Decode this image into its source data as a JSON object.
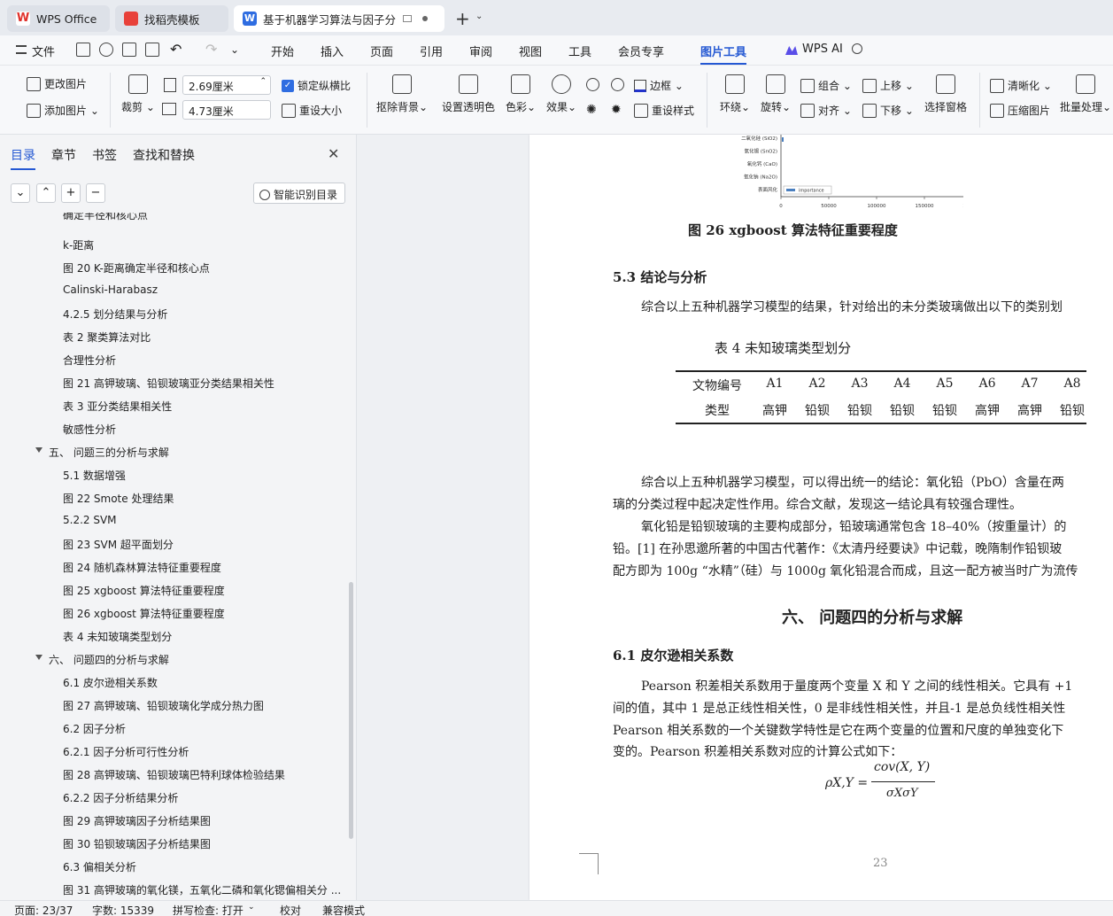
{
  "tabs": [
    {
      "label": "WPS Office"
    },
    {
      "label": "找稻壳模板"
    },
    {
      "label": "基于机器学习算法与因子分析的"
    }
  ],
  "menu": [
    "文件",
    "开始",
    "插入",
    "页面",
    "引用",
    "审阅",
    "视图",
    "工具",
    "会员专享",
    "图片工具",
    "WPS AI"
  ],
  "ribbon": {
    "change_image": "更改图片",
    "add_image": "添加图片",
    "crop": "裁剪",
    "height_value": "2.69厘米",
    "width_value": "4.73厘米",
    "lock_ratio": "锁定纵横比",
    "reset_size": "重设大小",
    "remove_bg": "抠除背景",
    "set_transparent": "设置透明色",
    "color": "色彩",
    "effect": "效果",
    "border": "边框",
    "reset_style": "重设样式",
    "wrap": "环绕",
    "rotate": "旋转",
    "group": "组合",
    "align": "对齐",
    "bring_forward": "上移",
    "send_backward": "下移",
    "selection_pane": "选择窗格",
    "sharpen": "清晰化",
    "compress": "压缩图片",
    "batch": "批量处理"
  },
  "nav": {
    "tabs": [
      "目录",
      "章节",
      "书签",
      "查找和替换"
    ],
    "smart_btn": "智能识别目录",
    "items": [
      {
        "t": "确定半径和核心点",
        "l": 2
      },
      {
        "t": "k-距离",
        "l": 2
      },
      {
        "t": "图 20 K-距离确定半径和核心点",
        "l": 2
      },
      {
        "t": "Calinski-Harabasz",
        "l": 2
      },
      {
        "t": "4.2.5 划分结果与分析",
        "l": 2
      },
      {
        "t": "表 2 聚类算法对比",
        "l": 2
      },
      {
        "t": "合理性分析",
        "l": 2
      },
      {
        "t": "图 21 高钾玻璃、铅钡玻璃亚分类结果相关性",
        "l": 2
      },
      {
        "t": "表 3 亚分类结果相关性",
        "l": 2
      },
      {
        "t": "敏感性分析",
        "l": 2
      },
      {
        "t": "五、 问题三的分析与求解",
        "l": 1
      },
      {
        "t": "5.1 数据增强",
        "l": 2
      },
      {
        "t": "图 22 Smote 处理结果",
        "l": 2
      },
      {
        "t": "5.2.2 SVM",
        "l": 2
      },
      {
        "t": "图 23 SVM 超平面划分",
        "l": 2
      },
      {
        "t": "图 24 随机森林算法特征重要程度",
        "l": 2
      },
      {
        "t": "图 25 xgboost 算法特征重要程度",
        "l": 2
      },
      {
        "t": "图 26 xgboost 算法特征重要程度",
        "l": 2
      },
      {
        "t": "表 4 未知玻璃类型划分",
        "l": 2
      },
      {
        "t": "六、 问题四的分析与求解",
        "l": 1
      },
      {
        "t": "6.1 皮尔逊相关系数",
        "l": 2
      },
      {
        "t": "图 27 高钾玻璃、铅钡玻璃化学成分热力图",
        "l": 2
      },
      {
        "t": "6.2 因子分析",
        "l": 2
      },
      {
        "t": "6.2.1 因子分析可行性分析",
        "l": 2
      },
      {
        "t": "图 28 高钾玻璃、铅钡玻璃巴特利球体检验结果",
        "l": 2
      },
      {
        "t": "6.2.2 因子分析结果分析",
        "l": 2
      },
      {
        "t": "图 29 高钾玻璃因子分析结果图",
        "l": 2
      },
      {
        "t": "图 30 铅钡玻璃因子分析结果图",
        "l": 2
      },
      {
        "t": "6.3 偏相关分析",
        "l": 2
      },
      {
        "t": "图 31 高钾玻璃的氧化镁，五氧化二磷和氧化锶偏相关分 ...",
        "l": 2
      }
    ]
  },
  "doc": {
    "chart_labels": [
      "二氧化硅 (SiO2)",
      "氧化锡 (SnO2)",
      "氧化钙 (CaO)",
      "氧化钠 (Na2O)",
      "表面风化"
    ],
    "chart_xticks": [
      "0",
      "50000",
      "100000",
      "150000",
      "200000",
      "250000"
    ],
    "chart_legend": "importance",
    "fig26": "图 26   xgboost 算法特征重要程度",
    "sec53": "5.3 结论与分析",
    "p1": "综合以上五种机器学习模型的结果，针对给出的未分类玻璃做出以下的类别划",
    "table_title": "表 4   未知玻璃类型划分",
    "table_head": [
      "文物编号",
      "A1",
      "A2",
      "A3",
      "A4",
      "A5",
      "A6",
      "A7",
      "A8"
    ],
    "table_row": [
      "类型",
      "高钾",
      "铅钡",
      "铅钡",
      "铅钡",
      "铅钡",
      "高钾",
      "高钾",
      "铅钡"
    ],
    "p2a": "综合以上五种机器学习模型，可以得出统一的结论：氧化铅（PbO）含量在两",
    "p2b": "璃的分类过程中起决定性作用。综合文献，发现这一结论具有较强合理性。",
    "p3a": "氧化铅是铅钡玻璃的主要构成部分，铅玻璃通常包含 18–40%（按重量计）的",
    "p3b": "铅。[1] 在孙思邈所著的中国古代著作：《太清丹经要诀》中记载，晚隋制作铅钡玻",
    "p3c": "配方即为 100g “水精”（硅）与 1000g 氧化铅混合而成，且这一配方被当时广为流传",
    "ch6": "六、 问题四的分析与求解",
    "sec61": "6.1 皮尔逊相关系数",
    "p4a": "Pearson 积差相关系数用于量度两个变量 X 和 Y 之间的线性相关。它具有 +1",
    "p4b": "间的值，其中 1 是总正线性相关性，0 是非线性相关性，并且-1 是总负线性相关性",
    "p4c": "Pearson 相关系数的一个关键数学特性是它在两个变量的位置和尺度的单独变化下",
    "p4d": "变的。Pearson 积差相关系数对应的计算公式如下：",
    "formula_lhs": "ρX,Y =",
    "formula_num": "cov(X, Y)",
    "formula_den": "σXσY",
    "page_no": "23"
  },
  "status": {
    "page": "页面: 23/37",
    "words": "字数: 15339",
    "spell": "拼写检查: 打开",
    "proof": "校对",
    "compat": "兼容模式"
  }
}
